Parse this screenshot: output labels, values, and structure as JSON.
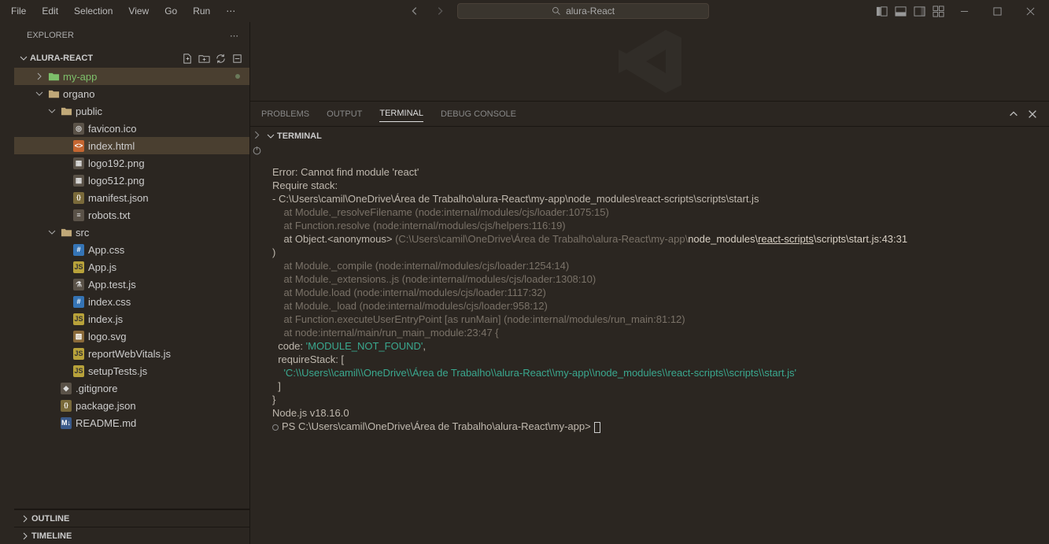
{
  "menubar": {
    "file": "File",
    "edit": "Edit",
    "selection": "Selection",
    "view": "View",
    "go": "Go",
    "run": "Run",
    "more": "⋯"
  },
  "search": {
    "text": "alura-React"
  },
  "sidebar": {
    "title": "EXPLORER",
    "root": "ALURA-REACT",
    "outline": "OUTLINE",
    "timeline": "TIMELINE",
    "tree": [
      {
        "label": "my-app",
        "icon": "folder-green",
        "chev": "right",
        "depth": 1,
        "cls": "myapp",
        "dot": true
      },
      {
        "label": "organo",
        "icon": "folder",
        "chev": "down",
        "depth": 1
      },
      {
        "label": "public",
        "icon": "folder",
        "chev": "down",
        "depth": 2
      },
      {
        "label": "favicon.ico",
        "icon": "generic",
        "iconText": "◎",
        "depth": 3
      },
      {
        "label": "index.html",
        "icon": "html",
        "iconText": "<>",
        "depth": 3,
        "cls": "selected"
      },
      {
        "label": "logo192.png",
        "icon": "generic",
        "iconText": "▦",
        "depth": 3
      },
      {
        "label": "logo512.png",
        "icon": "generic",
        "iconText": "▦",
        "depth": 3
      },
      {
        "label": "manifest.json",
        "icon": "json",
        "iconText": "{}",
        "depth": 3
      },
      {
        "label": "robots.txt",
        "icon": "generic",
        "iconText": "≡",
        "depth": 3
      },
      {
        "label": "src",
        "icon": "folder",
        "chev": "down",
        "depth": 2
      },
      {
        "label": "App.css",
        "icon": "css",
        "iconText": "#",
        "depth": 3
      },
      {
        "label": "App.js",
        "icon": "js",
        "iconText": "JS",
        "depth": 3
      },
      {
        "label": "App.test.js",
        "icon": "generic",
        "iconText": "⚗",
        "depth": 3
      },
      {
        "label": "index.css",
        "icon": "css",
        "iconText": "#",
        "depth": 3
      },
      {
        "label": "index.js",
        "icon": "js",
        "iconText": "JS",
        "depth": 3
      },
      {
        "label": "logo.svg",
        "icon": "svg",
        "iconText": "▧",
        "depth": 3
      },
      {
        "label": "reportWebVitals.js",
        "icon": "js",
        "iconText": "JS",
        "depth": 3
      },
      {
        "label": "setupTests.js",
        "icon": "js",
        "iconText": "JS",
        "depth": 3
      },
      {
        "label": ".gitignore",
        "icon": "generic",
        "iconText": "◆",
        "depth": 2
      },
      {
        "label": "package.json",
        "icon": "json",
        "iconText": "{}",
        "depth": 2
      },
      {
        "label": "README.md",
        "icon": "md",
        "iconText": "M↓",
        "depth": 2
      }
    ]
  },
  "panel": {
    "problems": "PROBLEMS",
    "output": "OUTPUT",
    "terminal": "TERMINAL",
    "debug": "DEBUG CONSOLE",
    "header": "TERMINAL"
  },
  "terminal": {
    "l1": "Error: Cannot find module 'react'",
    "l2": "Require stack:",
    "l3": "- C:\\Users\\camil\\OneDrive\\Área de Trabalho\\alura-React\\my-app\\node_modules\\react-scripts\\scripts\\start.js",
    "l4": "    at Module._resolveFilename (node:internal/modules/cjs/loader:1075:15)",
    "l5": "    at Function.resolve (node:internal/modules/cjs/helpers:116:19)",
    "l6a": "    at Object.<anonymous> ",
    "l6b": "(C:\\Users\\camil\\OneDrive\\Área de Trabalho\\alura-React\\my-app\\",
    "l6c": "node_modules\\",
    "l6d": "react-scripts",
    "l6e": "\\scripts\\start.js:43:31",
    "l7": ")",
    "l8": "    at Module._compile (node:internal/modules/cjs/loader:1254:14)",
    "l9": "    at Module._extensions..js (node:internal/modules/cjs/loader:1308:10)",
    "l10": "    at Module.load (node:internal/modules/cjs/loader:1117:32)",
    "l11": "    at Module._load (node:internal/modules/cjs/loader:958:12)",
    "l12": "    at Function.executeUserEntryPoint [as runMain] (node:internal/modules/run_main:81:12)",
    "l13": "    at node:internal/main/run_main_module:23:47 {",
    "l14a": "  code: ",
    "l14b": "'MODULE_NOT_FOUND'",
    "l14c": ",",
    "l15": "  requireStack: [",
    "l16": "    'C:\\\\Users\\\\camil\\\\OneDrive\\\\Área de Trabalho\\\\alura-React\\\\my-app\\\\node_modules\\\\react-scripts\\\\scripts\\\\start.js'",
    "l17": "  ]",
    "l18": "}",
    "l19": "",
    "l20": "Node.js v18.16.0",
    "l21": "PS C:\\Users\\camil\\OneDrive\\Área de Trabalho\\alura-React\\my-app>"
  }
}
